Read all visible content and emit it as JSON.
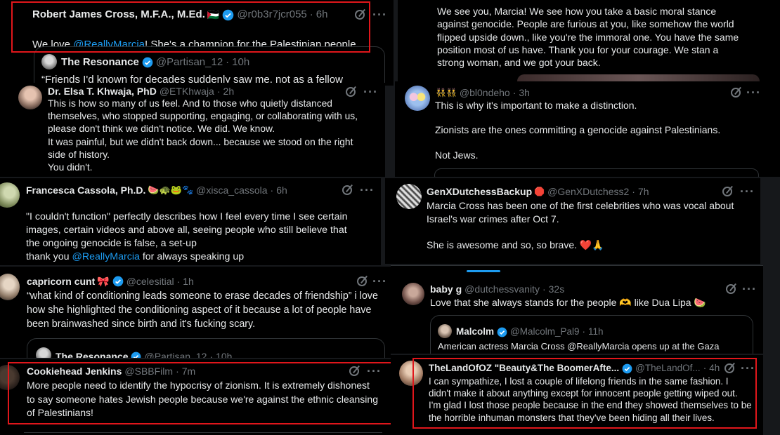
{
  "tweets": {
    "robert": {
      "name": "Robert James Cross, M.F.A., M.Ed.",
      "flag": "🇵🇸",
      "handle": "@r0b3r7jcr055",
      "time": "6h",
      "text_a": "We love ",
      "mention": "@ReallyMarcia",
      "text_b": "! She's a champion for the Palestinian people.",
      "quote": {
        "name": "The Resonance",
        "handle": "@Partisan_12",
        "time": "10h",
        "text": "“Friends I'd known for decades suddenly saw me, not as a fellow"
      }
    },
    "we_see_you": {
      "text": "We see you, Marcia! We see how you take a basic moral stance against genocide. People are furious at you, like somehow the world flipped upside down., like you're the immoral one. You have the same position most of us have. Thank you for your courage. We stan a strong woman, and we got your back."
    },
    "elsa": {
      "name": "Dr. Elsa T. Khwaja, PhD",
      "handle": "@ETKhwaja",
      "time": "2h",
      "text": "This is how so many of us feel. And to those who quietly distanced themselves, who stopped supporting, engaging, or collaborating with us, please don't think we didn't notice. We did. We know.\nIt was painful, but we didn't back down... because we stood on the right side of history.\nYou didn't."
    },
    "bl0ndeho": {
      "emoji": "👯👯",
      "handle": "@bl0ndeho",
      "time": "3h",
      "text": "This is why it's important to make a distinction.\n\nZionists are the ones committing a genocide against Palestinians.\n\nNot Jews."
    },
    "francesca": {
      "name": "Francesca Cassola, Ph.D.",
      "emoji": "🍉🐢🐸🐾",
      "handle": "@xisca_cassola",
      "time": "6h",
      "text_a": "\"I couldn't function\" perfectly describes how I feel every time I see certain images, certain videos and above all, seeing people who still believe that the ongoing genocide is false, a set-up\nthank you ",
      "mention": "@ReallyMarcia",
      "text_b": " for always speaking up"
    },
    "genx": {
      "name": "GenXDutchessBackup",
      "emoji": "🛑",
      "handle": "@GenXDutchess2",
      "time": "7h",
      "text": "Marcia Cross has been one of the first celebrities who was vocal about Israel's war crimes after Oct 7.\n\nShe is awesome and so, so brave. ❤️🙏"
    },
    "capricorn": {
      "name": "capricorn cunt",
      "emoji": "🎀",
      "handle": "@celesitial",
      "time": "1h",
      "text": "“what kind of conditioning leads someone to erase decades of friendship” i love how she highlighted the conditioning aspect of it because a lot of people have been brainwashed since birth and it's fucking scary.",
      "quote": {
        "name": "The Resonance",
        "handle": "@Partisan_12",
        "time": "10h"
      }
    },
    "babyg": {
      "name": "baby g",
      "handle": "@dutchessvanity",
      "time": "32s",
      "text": "Love that she always stands for the people 🫶 like Dua Lipa 🍉",
      "quote": {
        "name": "Malcolm",
        "handle": "@Malcolm_Pal9",
        "time": "11h",
        "text": "American actress Marcia Cross @ReallyMarcia opens up at the Gaza"
      }
    },
    "cookiehead": {
      "name": "Cookiehead Jenkins",
      "handle": "@SBBFilm",
      "time": "7m",
      "text": "More people need to identify the hypocrisy of zionism. It is extremely dishonest to say someone hates Jewish people because we're against the ethnic cleansing of Palestinians!"
    },
    "landofoz": {
      "name": "TheLandOfOZ \"Beauty&The BoomerAfte...",
      "handle": "@TheLandOf...",
      "time": "4h",
      "text": "I can sympathize, I lost a couple of lifelong friends in the same fashion. I didn't make it about anything except for innocent people getting wiped out. I'm glad I lost those people because in the end they showed themselves to be the horrible inhuman monsters that they've been hiding all their lives."
    }
  },
  "colors": {
    "background": "#000000",
    "text": "#e7e9ea",
    "muted": "#71767b",
    "link": "#1d9bf0",
    "highlight_box": "#e0161b",
    "verified": "#1d9bf0"
  }
}
